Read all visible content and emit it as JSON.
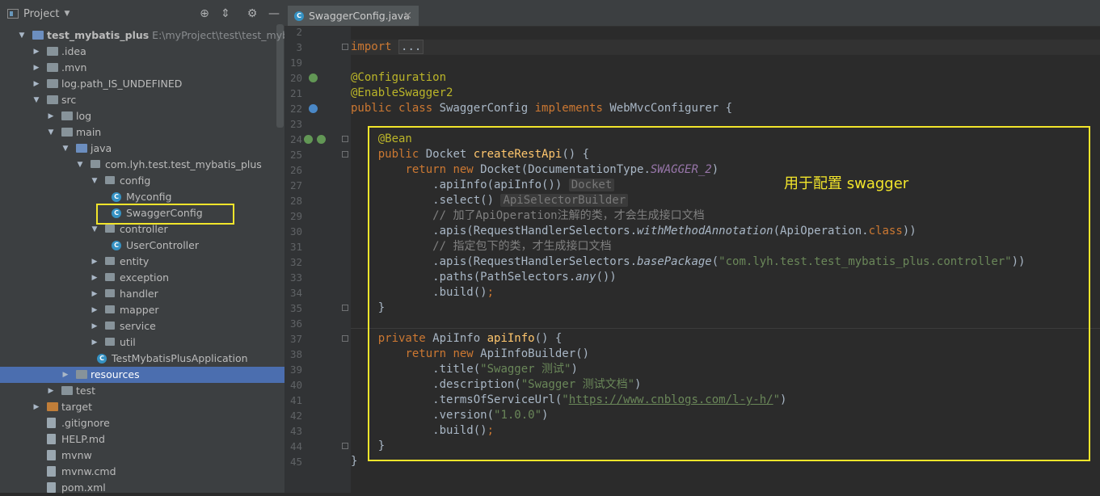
{
  "project_panel": {
    "title": "Project",
    "toolbar_icons": [
      "crosshair-icon",
      "collapse-icon",
      "gear-icon",
      "minimize-icon"
    ],
    "tree": [
      {
        "label": "test_mybatis_plus",
        "path": "E:\\myProject\\test\\test_mybatis_plu",
        "type": "module",
        "expanded": true
      },
      {
        "label": ".idea",
        "type": "folder",
        "expanded": false
      },
      {
        "label": ".mvn",
        "type": "folder",
        "expanded": false
      },
      {
        "label": "log.path_IS_UNDEFINED",
        "type": "folder",
        "expanded": false
      },
      {
        "label": "src",
        "type": "folder",
        "expanded": true
      },
      {
        "label": "log",
        "type": "folder",
        "expanded": false
      },
      {
        "label": "main",
        "type": "folder",
        "expanded": true
      },
      {
        "label": "java",
        "type": "source-folder",
        "expanded": true
      },
      {
        "label": "com.lyh.test.test_mybatis_plus",
        "type": "package",
        "expanded": true
      },
      {
        "label": "config",
        "type": "package",
        "expanded": true
      },
      {
        "label": "Myconfig",
        "type": "class"
      },
      {
        "label": "SwaggerConfig",
        "type": "class",
        "highlighted": true
      },
      {
        "label": "controller",
        "type": "package",
        "expanded": true
      },
      {
        "label": "UserController",
        "type": "class"
      },
      {
        "label": "entity",
        "type": "package",
        "expanded": false
      },
      {
        "label": "exception",
        "type": "package",
        "expanded": false
      },
      {
        "label": "handler",
        "type": "package",
        "expanded": false
      },
      {
        "label": "mapper",
        "type": "package",
        "expanded": false
      },
      {
        "label": "service",
        "type": "package",
        "expanded": false
      },
      {
        "label": "util",
        "type": "package",
        "expanded": false
      },
      {
        "label": "TestMybatisPlusApplication",
        "type": "class"
      },
      {
        "label": "resources",
        "type": "resource-folder",
        "expanded": false,
        "selected": true
      },
      {
        "label": "test",
        "type": "folder",
        "expanded": false
      },
      {
        "label": "target",
        "type": "excluded-folder",
        "expanded": false
      },
      {
        "label": ".gitignore",
        "type": "file"
      },
      {
        "label": "HELP.md",
        "type": "file"
      },
      {
        "label": "mvnw",
        "type": "file"
      },
      {
        "label": "mvnw.cmd",
        "type": "file"
      },
      {
        "label": "pom.xml",
        "type": "file"
      }
    ]
  },
  "editor": {
    "tab": {
      "label": "SwaggerConfig.java",
      "close": "×"
    },
    "annotation_note": "用于配置 swagger",
    "lines": [
      {
        "n": "2",
        "html": ""
      },
      {
        "n": "3",
        "html": "<span class=\"kw\">import</span> <span class=\"importbox\">...</span>"
      },
      {
        "n": "19",
        "html": ""
      },
      {
        "n": "20",
        "html": "<span class=\"ann\">@Configuration</span>"
      },
      {
        "n": "21",
        "html": "<span class=\"ann\">@EnableSwagger2</span>"
      },
      {
        "n": "22",
        "html": "<span class=\"kw\">public class </span>SwaggerConfig <span class=\"kw\">implements </span>WebMvcConfigurer {"
      },
      {
        "n": "23",
        "html": ""
      },
      {
        "n": "24",
        "html": "    <span class=\"ann\">@Bean</span>"
      },
      {
        "n": "25",
        "html": "    <span class=\"kw\">public </span>Docket <span class=\"fn\">createRestApi</span>() {"
      },
      {
        "n": "26",
        "html": "        <span class=\"kw\">return new </span>Docket(DocumentationType.<span class=\"it\">SWAGGER_2</span>)"
      },
      {
        "n": "27",
        "html": "            .apiInfo(apiInfo()) <span class=\"hint\">Docket</span>"
      },
      {
        "n": "28",
        "html": "            .select() <span class=\"hint\">ApiSelectorBuilder</span>"
      },
      {
        "n": "29",
        "html": "            <span class=\"cm\">// 加了ApiOperation注解的类，才会生成接口文档</span>"
      },
      {
        "n": "30",
        "html": "            .apis(RequestHandlerSelectors.<span class=\"sit\">withMethodAnnotation</span>(ApiOperation.<span class=\"kw\">class</span>))"
      },
      {
        "n": "31",
        "html": "            <span class=\"cm\">// 指定包下的类，才生成接口文档</span>"
      },
      {
        "n": "32",
        "html": "            .apis(RequestHandlerSelectors.<span class=\"sit\">basePackage</span>(<span class=\"str\">\"com.lyh.test.test_mybatis_plus.controller\"</span>))"
      },
      {
        "n": "33",
        "html": "            .paths(PathSelectors.<span class=\"sit\">any</span>())"
      },
      {
        "n": "34",
        "html": "            .build()<span class=\"kw\">;</span>"
      },
      {
        "n": "35",
        "html": "    }"
      },
      {
        "n": "36",
        "html": ""
      },
      {
        "n": "37",
        "html": "    <span class=\"kw\">private </span>ApiInfo <span class=\"fn\">apiInfo</span>() {"
      },
      {
        "n": "38",
        "html": "        <span class=\"kw\">return new </span>ApiInfoBuilder()"
      },
      {
        "n": "39",
        "html": "            .title(<span class=\"str\">\"Swagger 测试\"</span>)"
      },
      {
        "n": "40",
        "html": "            .description(<span class=\"str\">\"Swagger 测试文档\"</span>)"
      },
      {
        "n": "41",
        "html": "            .termsOfServiceUrl(<span class=\"str\">\"<span class=\"lnk\">https://www.cnblogs.com/l-y-h/</span>\"</span>)"
      },
      {
        "n": "42",
        "html": "            .version(<span class=\"str\">\"1.0.0\"</span>)"
      },
      {
        "n": "43",
        "html": "            .build()<span class=\"kw\">;</span>"
      },
      {
        "n": "44",
        "html": "    }"
      },
      {
        "n": "45",
        "html": "}"
      }
    ]
  },
  "colors": {
    "highlight_box": "#f2e52b",
    "selection": "#4b6eaf",
    "keyword": "#cc7832",
    "annotation": "#bbb529",
    "string": "#6a8759"
  }
}
